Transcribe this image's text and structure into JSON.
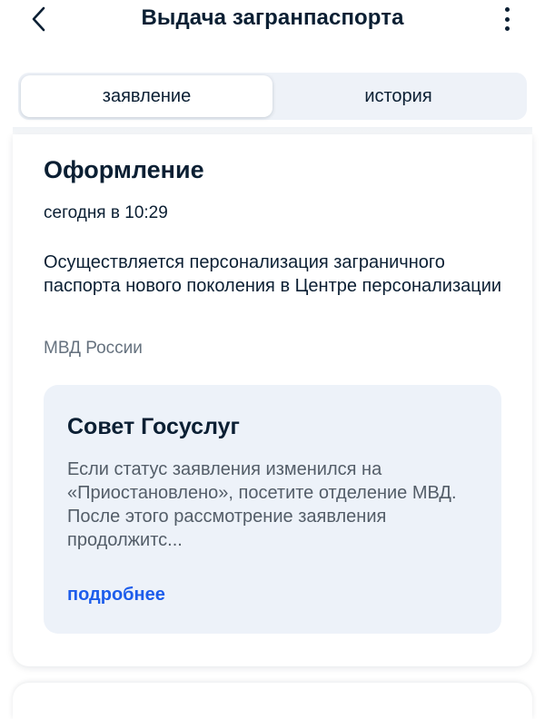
{
  "header": {
    "title": "Выдача загранпаспорта"
  },
  "tabs": [
    {
      "label": "заявление",
      "active": true
    },
    {
      "label": "история",
      "active": false
    }
  ],
  "status": {
    "title": "Оформление",
    "time": "сегодня в 10:29",
    "description": "Осуществляется персонализация заграничного паспорта нового поколения в Центре персонализации",
    "department": "МВД России"
  },
  "tip": {
    "title": "Совет Госуслуг",
    "text": "Если статус заявления изменился на «Приостановлено», посетите отделение МВД. После этого рассмотрение заявления продолжитс...",
    "link": "подробнее"
  },
  "colors": {
    "accent": "#1d5deb",
    "text_primary": "#0b1f33",
    "text_secondary": "#66727f",
    "tip_background": "#edf2f9",
    "tabs_background": "#eef2f8"
  }
}
